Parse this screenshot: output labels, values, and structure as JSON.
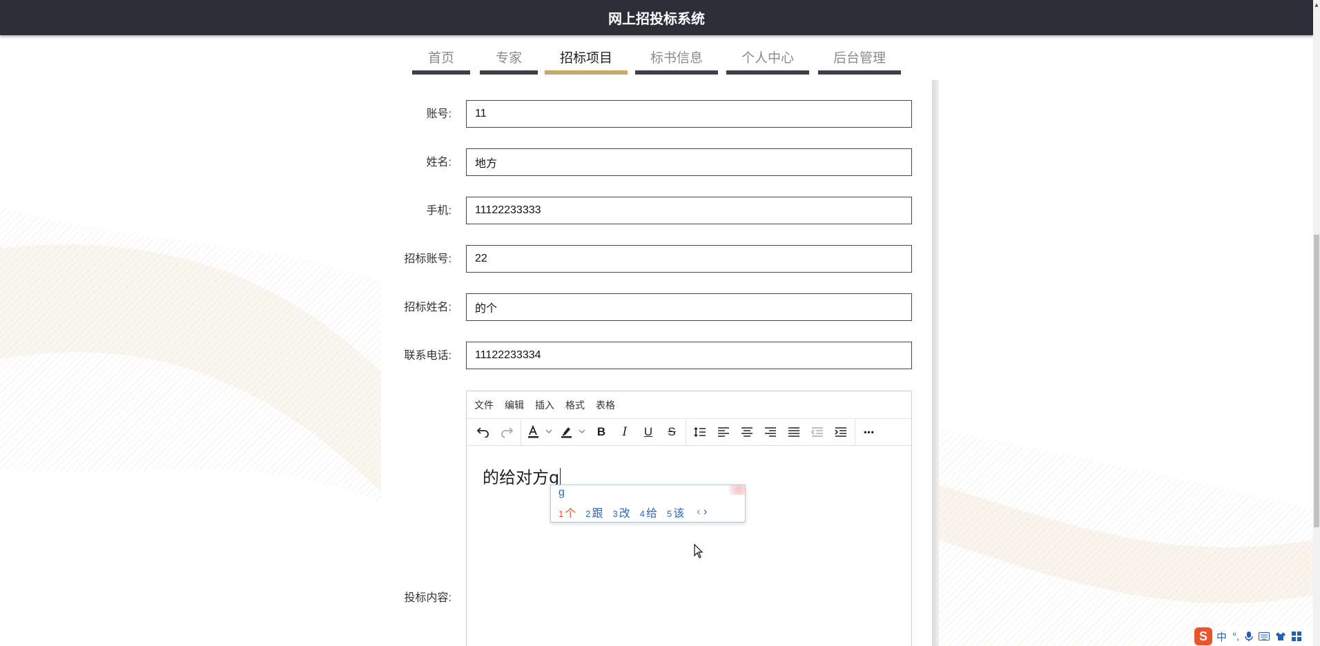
{
  "header": {
    "title": "网上招投标系统"
  },
  "nav": {
    "tabs": [
      {
        "label": "首页",
        "active": false
      },
      {
        "label": "专家",
        "active": false
      },
      {
        "label": "招标项目",
        "active": true
      },
      {
        "label": "标书信息",
        "active": false
      },
      {
        "label": "个人中心",
        "active": false
      },
      {
        "label": "后台管理",
        "active": false
      }
    ]
  },
  "form": {
    "fields": [
      {
        "label": "账号:",
        "value": "11"
      },
      {
        "label": "姓名:",
        "value": "地方"
      },
      {
        "label": "手机:",
        "value": "11122233333"
      },
      {
        "label": "招标账号:",
        "value": "22"
      },
      {
        "label": "招标姓名:",
        "value": "的个"
      },
      {
        "label": "联系电话:",
        "value": "11122233334"
      }
    ],
    "content_label": "投标内容:"
  },
  "editor": {
    "menu": [
      "文件",
      "编辑",
      "插入",
      "格式",
      "表格"
    ],
    "content": "的给对方g",
    "toolbar_icons": [
      "undo-icon",
      "redo-icon",
      "text-color-icon",
      "highlight-color-icon",
      "bold-icon",
      "italic-icon",
      "underline-icon",
      "strikethrough-icon",
      "line-height-icon",
      "align-left-icon",
      "align-center-icon",
      "align-right-icon",
      "align-justify-icon",
      "outdent-icon",
      "indent-icon",
      "more-icon"
    ],
    "bold_glyph": "B",
    "italic_glyph": "I",
    "underline_glyph": "U",
    "strike_glyph": "S",
    "more_glyph": "•••"
  },
  "ime": {
    "input": "g",
    "candidates": [
      {
        "num": "1",
        "text": "个"
      },
      {
        "num": "2",
        "text": "跟"
      },
      {
        "num": "3",
        "text": "改"
      },
      {
        "num": "4",
        "text": "给"
      },
      {
        "num": "5",
        "text": "该"
      }
    ],
    "prev": "‹",
    "next": "›"
  },
  "tray": {
    "logo": "S",
    "lang": "中",
    "punct": "°,",
    "items": [
      "microphone-icon",
      "keyboard-icon",
      "skin-icon",
      "toolbox-icon"
    ]
  },
  "colors": {
    "header_bg": "#2b2e36",
    "active_tab": "#c9a967",
    "tab_underline": "#3f4045",
    "ime_candidate": "#2b66c2",
    "ime_first": "#e2582a"
  }
}
